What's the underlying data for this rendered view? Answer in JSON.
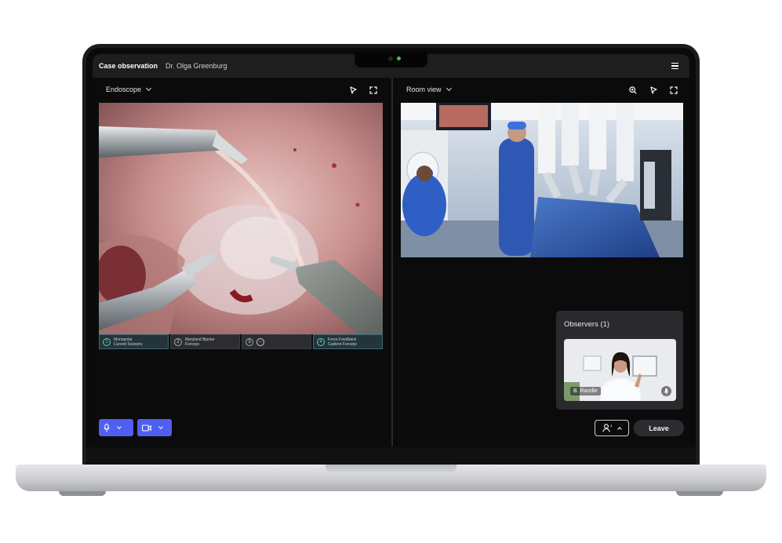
{
  "header": {
    "title": "Case observation",
    "doctor": "Dr. Olga Greenburg",
    "menu_icon": "hamburger-menu-icon"
  },
  "left_panel": {
    "source_label": "Endoscope",
    "icons": [
      "pointer-icon",
      "expand-icon"
    ],
    "instruments": [
      {
        "slot": "1",
        "name_line1": "Monopolar",
        "name_line2": "Curved Scissors",
        "active": true
      },
      {
        "slot": "2",
        "name_line1": "Maryland Bipolar",
        "name_line2": "Forceps",
        "active": false
      },
      {
        "slot": "3",
        "name_line1": "",
        "name_line2": "",
        "active": false
      },
      {
        "slot": "4",
        "name_line1": "Force Feedback",
        "name_line2": "Cadiere Forceps",
        "active": true
      }
    ],
    "controls": [
      "microphone-icon",
      "camera-icon"
    ]
  },
  "right_panel": {
    "source_label": "Room view",
    "icons": [
      "zoom-in-icon",
      "pointer-icon",
      "expand-icon"
    ]
  },
  "observers": {
    "title": "Observers (1)",
    "observer_name": "B. Randle"
  },
  "footer": {
    "participants_count": "1",
    "leave_label": "Leave"
  },
  "colors": {
    "accent_blue": "#4f5ff0",
    "top_bar": "#1e1e20",
    "panel_bg": "#0b0b0c"
  }
}
